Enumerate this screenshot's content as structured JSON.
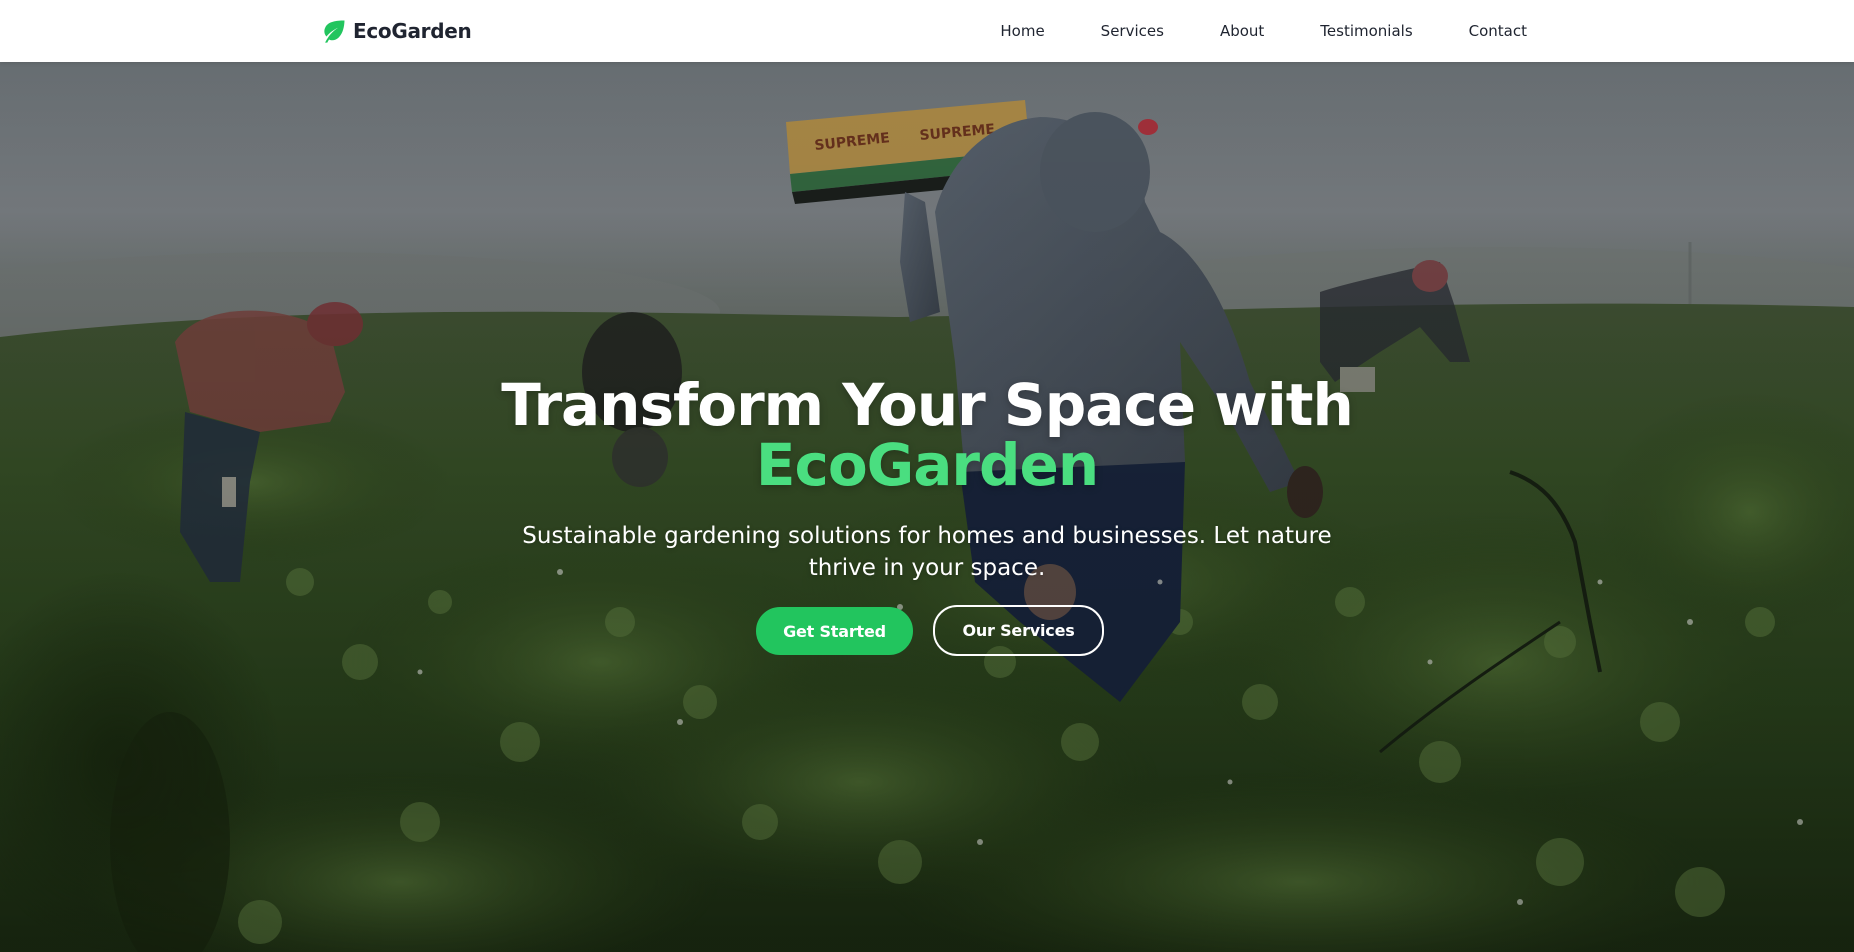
{
  "brand": {
    "name": "EcoGarden",
    "icon": "leaf-icon",
    "icon_color": "#22c55e"
  },
  "nav": {
    "links": [
      "Home",
      "Services",
      "About",
      "Testimonials",
      "Contact"
    ]
  },
  "hero": {
    "title_main": "Transform Your Space with",
    "title_accent": "EcoGarden",
    "subtitle": "Sustainable gardening solutions for homes and businesses. Let nature thrive in your space.",
    "primary_button": "Get Started",
    "secondary_button": "Our Services",
    "accent_color": "#4ade80",
    "button_color": "#22c55e"
  }
}
